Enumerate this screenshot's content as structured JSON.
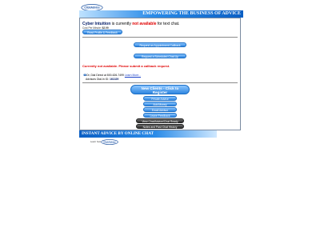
{
  "logo": {
    "text": "ClickAdvice"
  },
  "banner": {
    "title": "EMPOWERING THE BUSINESS OF ADVICE"
  },
  "expert": {
    "name": "Cyber Intuition",
    "status_prefix": " is currently ",
    "status": "not available",
    "status_suffix": " for text chat.",
    "rate_label": "Cost Per Minute: ",
    "rate": "$2.99"
  },
  "buttons": {
    "feedback": "Read Profile & Feedback",
    "appointment": "Request an Appointment Callback",
    "scheduled": "Request a Scheduled Chat-Up"
  },
  "warning": "Currently not available. Please submit a callback request.",
  "phone": {
    "icon": "phone-icon",
    "text": "Or, Dial Direct at 800-626-7499 ",
    "link": "Learn More..."
  },
  "pin": {
    "label": "Advisors Dial-In ID: ",
    "value": "161329"
  },
  "new_clients": {
    "line1": "New Clients - Click to",
    "line2": "Register"
  },
  "member_buttons": [
    {
      "label": "Private Advice",
      "style": "blue"
    },
    {
      "label": "Add Money",
      "style": "blue"
    },
    {
      "label": "Email Advisor",
      "style": "blue"
    },
    {
      "label": "Leave Feedback",
      "style": "blue"
    },
    {
      "label": "View Chat/Advice/Chat Ready",
      "style": "dark"
    },
    {
      "label": "Notes and Past Chat History",
      "style": "dark"
    }
  ],
  "bottom_bar": {
    "title": "INSTANT ADVICE BY ONLINE CHAT"
  },
  "footer": {
    "text": "Learn how by",
    "logo": "ClickAdvice"
  },
  "colors": {
    "accent": "#2f86e0",
    "banner_dark": "#0b5fc4",
    "alert": "#e00000",
    "dark_button": "#2c2c2c"
  }
}
